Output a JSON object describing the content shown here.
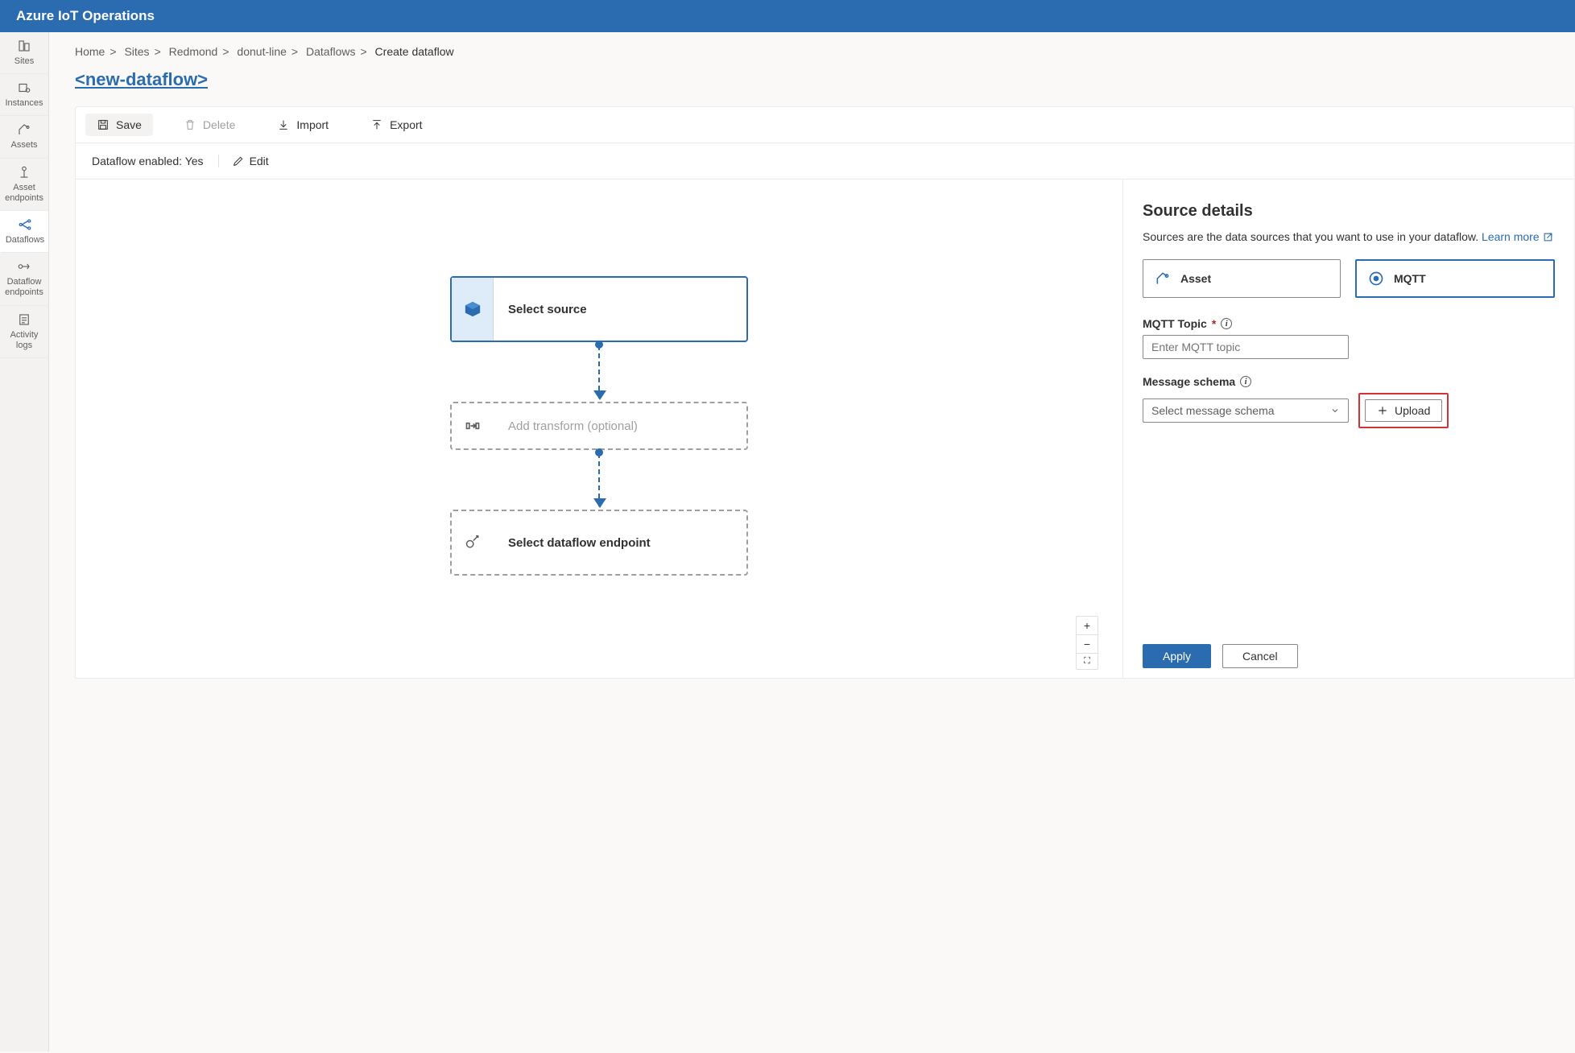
{
  "header": {
    "title": "Azure IoT Operations"
  },
  "sidebar": {
    "items": [
      {
        "label": "Sites"
      },
      {
        "label": "Instances"
      },
      {
        "label": "Assets"
      },
      {
        "label": "Asset endpoints"
      },
      {
        "label": "Dataflows"
      },
      {
        "label": "Dataflow endpoints"
      },
      {
        "label": "Activity logs"
      }
    ]
  },
  "breadcrumb": {
    "items": [
      "Home",
      "Sites",
      "Redmond",
      "donut-line",
      "Dataflows"
    ],
    "current": "Create dataflow"
  },
  "page": {
    "title": "<new-dataflow>"
  },
  "toolbar": {
    "save": "Save",
    "delete": "Delete",
    "import": "Import",
    "export": "Export"
  },
  "status": {
    "text": "Dataflow enabled: Yes",
    "edit": "Edit"
  },
  "canvas": {
    "source": "Select source",
    "transform": "Add transform (optional)",
    "endpoint": "Select dataflow endpoint"
  },
  "details": {
    "heading": "Source details",
    "description": "Sources are the data sources that you want to use in your dataflow. ",
    "learn_more": "Learn more",
    "type_asset": "Asset",
    "type_mqtt": "MQTT",
    "mqtt_topic_label": "MQTT Topic",
    "mqtt_topic_placeholder": "Enter MQTT topic",
    "schema_label": "Message schema",
    "schema_placeholder": "Select message schema",
    "upload": "Upload",
    "apply": "Apply",
    "cancel": "Cancel"
  },
  "zoom": {
    "in": "+",
    "out": "−",
    "fit": "⛶"
  }
}
